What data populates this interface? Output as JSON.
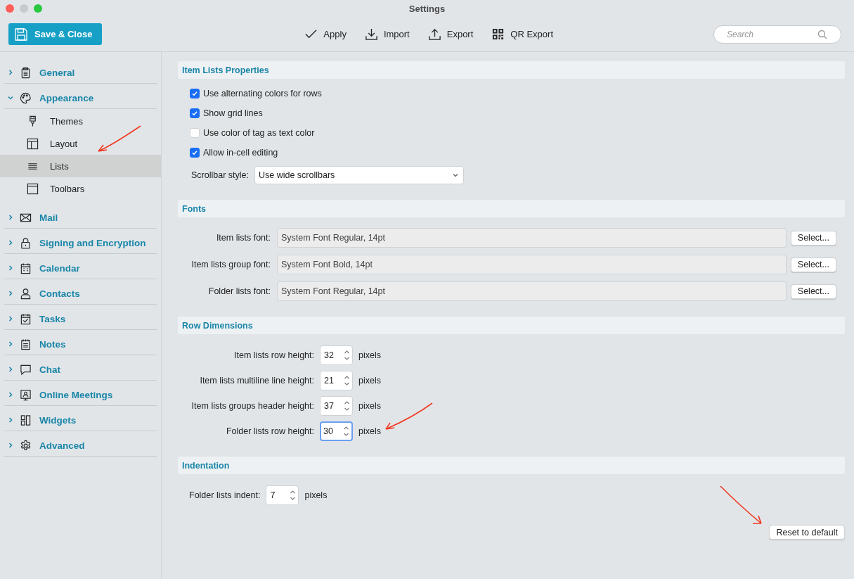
{
  "window": {
    "title": "Settings"
  },
  "toolbar": {
    "save_button": "Save & Close",
    "actions": [
      {
        "label": "Apply"
      },
      {
        "label": "Import"
      },
      {
        "label": "Export"
      },
      {
        "label": "QR Export"
      }
    ],
    "search": {
      "placeholder": "Search"
    }
  },
  "sidebar": {
    "items": [
      {
        "label": "General",
        "expanded": false,
        "selected": false
      },
      {
        "label": "Appearance",
        "expanded": true,
        "selected": false,
        "children": [
          {
            "label": "Themes",
            "selected": false
          },
          {
            "label": "Layout",
            "selected": false
          },
          {
            "label": "Lists",
            "selected": true
          },
          {
            "label": "Toolbars",
            "selected": false
          }
        ]
      },
      {
        "label": "Mail",
        "expanded": false,
        "selected": false
      },
      {
        "label": "Signing and Encryption",
        "expanded": false,
        "selected": false
      },
      {
        "label": "Calendar",
        "expanded": false,
        "selected": false
      },
      {
        "label": "Contacts",
        "expanded": false,
        "selected": false
      },
      {
        "label": "Tasks",
        "expanded": false,
        "selected": false
      },
      {
        "label": "Notes",
        "expanded": false,
        "selected": false
      },
      {
        "label": "Chat",
        "expanded": false,
        "selected": false
      },
      {
        "label": "Online Meetings",
        "expanded": false,
        "selected": false
      },
      {
        "label": "Widgets",
        "expanded": false,
        "selected": false
      },
      {
        "label": "Advanced",
        "expanded": false,
        "selected": false
      }
    ]
  },
  "sections": [
    {
      "title": "Item Lists Properties",
      "checkboxes": [
        {
          "label": "Use alternating colors for rows",
          "checked": true
        },
        {
          "label": "Show grid lines",
          "checked": true
        },
        {
          "label": "Use color of tag as text color",
          "checked": false
        },
        {
          "label": "Allow in-cell editing",
          "checked": true
        }
      ],
      "dropdown": {
        "label": "Scrollbar style:",
        "value": "Use wide scrollbars"
      }
    },
    {
      "title": "Fonts",
      "fonts": [
        {
          "label": "Item lists font:",
          "value": "System Font Regular, 14pt",
          "button": "Select..."
        },
        {
          "label": "Item lists group font:",
          "value": "System Font Bold, 14pt",
          "button": "Select..."
        },
        {
          "label": "Folder lists font:",
          "value": "System Font Regular, 14pt",
          "button": "Select..."
        }
      ]
    },
    {
      "title": "Row Dimensions",
      "kind": "aligned",
      "spinners": [
        {
          "label": "Item lists row height:",
          "value": "32",
          "unit": "pixels",
          "focused": false
        },
        {
          "label": "Item lists multiline line height:",
          "value": "21",
          "unit": "pixels",
          "focused": false
        },
        {
          "label": "Item lists groups header height:",
          "value": "37",
          "unit": "pixels",
          "focused": false
        },
        {
          "label": "Folder lists row height:",
          "value": "30",
          "unit": "pixels",
          "focused": true
        }
      ]
    },
    {
      "title": "Indentation",
      "kind": "inline",
      "spinners": [
        {
          "label": "Folder lists indent:",
          "value": "7",
          "unit": "pixels",
          "focused": false
        }
      ]
    }
  ],
  "reset_button": "Reset to default"
}
